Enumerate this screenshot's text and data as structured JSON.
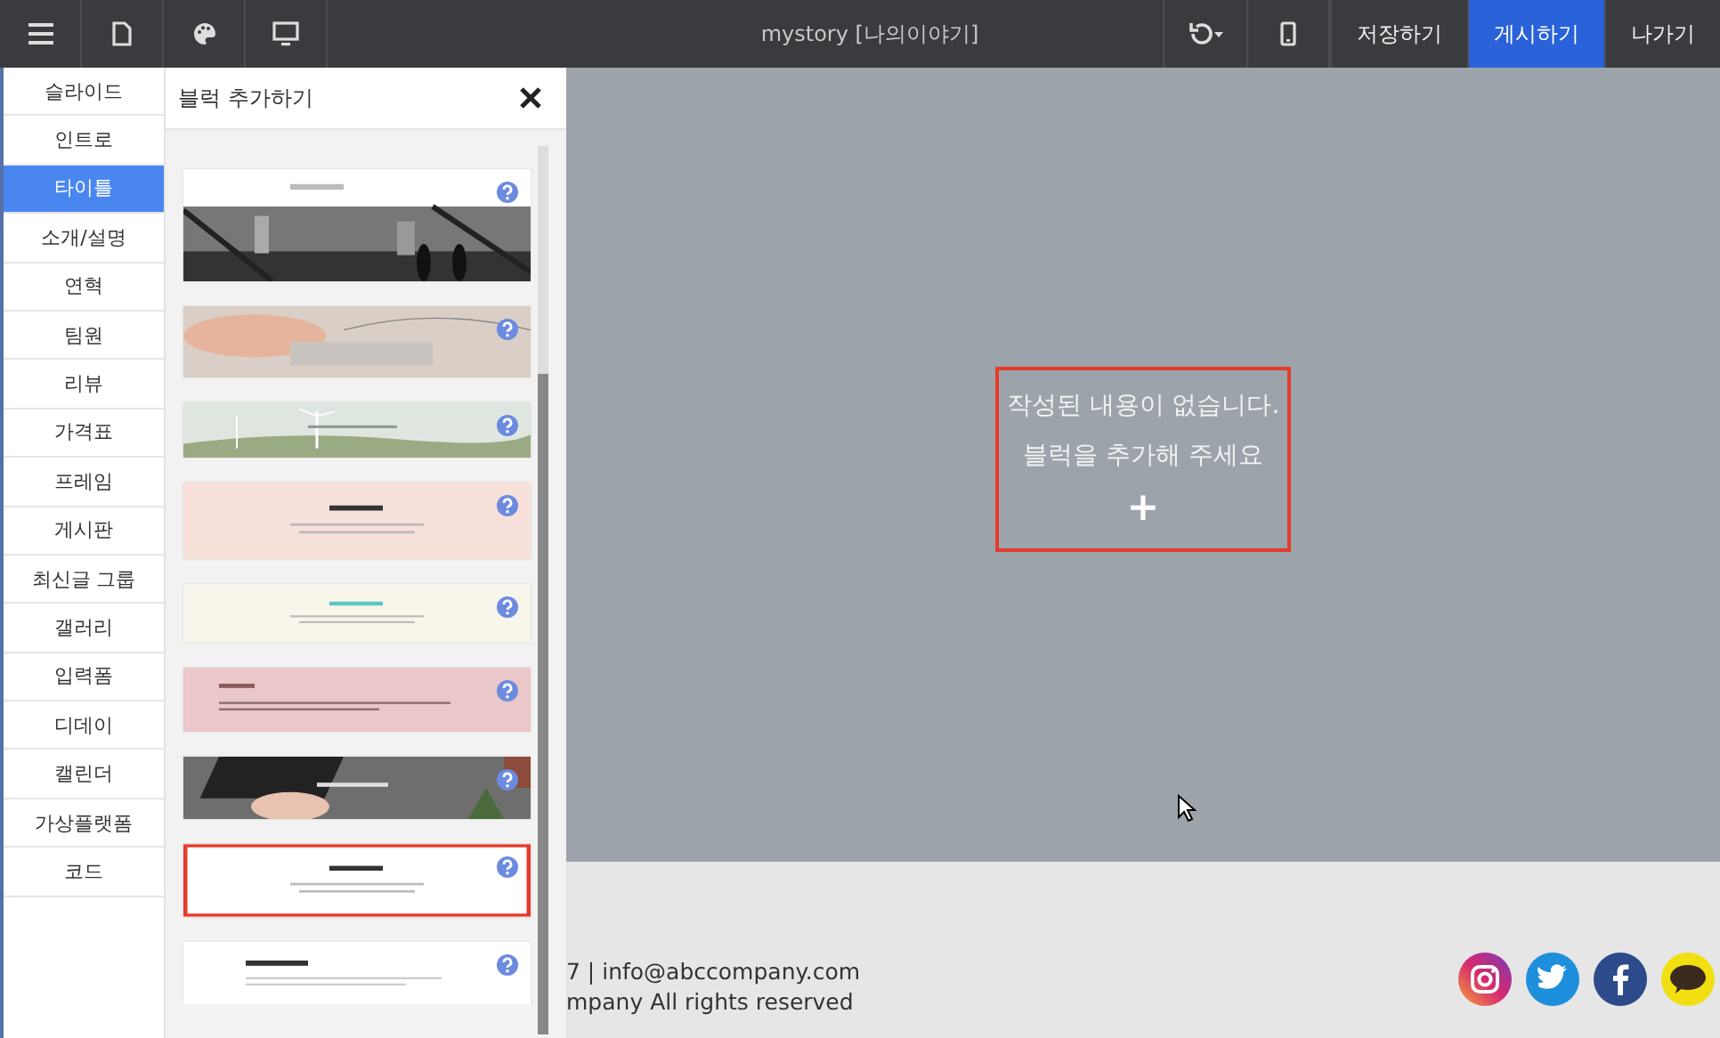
{
  "toolbar": {
    "title": "mystory [나의이야기]",
    "buttons": [
      {
        "label": "저장하기",
        "primary": false
      },
      {
        "label": "게시하기",
        "primary": true
      },
      {
        "label": "나가기",
        "primary": false
      }
    ]
  },
  "categories": [
    {
      "label": "슬라이드",
      "selected": false
    },
    {
      "label": "인트로",
      "selected": false
    },
    {
      "label": "타이틀",
      "selected": true
    },
    {
      "label": "소개/설명",
      "selected": false
    },
    {
      "label": "연혁",
      "selected": false
    },
    {
      "label": "팀원",
      "selected": false
    },
    {
      "label": "리뷰",
      "selected": false
    },
    {
      "label": "가격표",
      "selected": false
    },
    {
      "label": "프레임",
      "selected": false
    },
    {
      "label": "게시판",
      "selected": false
    },
    {
      "label": "최신글 그룹",
      "selected": false
    },
    {
      "label": "갤러리",
      "selected": false
    },
    {
      "label": "입력폼",
      "selected": false
    },
    {
      "label": "디데이",
      "selected": false
    },
    {
      "label": "캘린더",
      "selected": false
    },
    {
      "label": "가상플랫폼",
      "selected": false
    },
    {
      "label": "코드",
      "selected": false
    }
  ],
  "panel": {
    "title": "블럭 추가하기",
    "blocks": [
      {
        "kind": "city",
        "selected": false
      },
      {
        "kind": "hands",
        "selected": false
      },
      {
        "kind": "wind",
        "selected": false
      },
      {
        "kind": "peach",
        "selected": false
      },
      {
        "kind": "cream",
        "selected": false
      },
      {
        "kind": "pink",
        "selected": false
      },
      {
        "kind": "keyboard",
        "selected": false
      },
      {
        "kind": "white",
        "selected": true
      },
      {
        "kind": "contact",
        "selected": false
      }
    ]
  },
  "canvas": {
    "empty_lines": [
      "작성된 내용이 없습니다.",
      "블럭을 추가해 주세요"
    ],
    "add_symbol": "+"
  },
  "footer": {
    "lines": [
      "7 | info@abccompany.com",
      "mpany All rights reserved"
    ]
  }
}
